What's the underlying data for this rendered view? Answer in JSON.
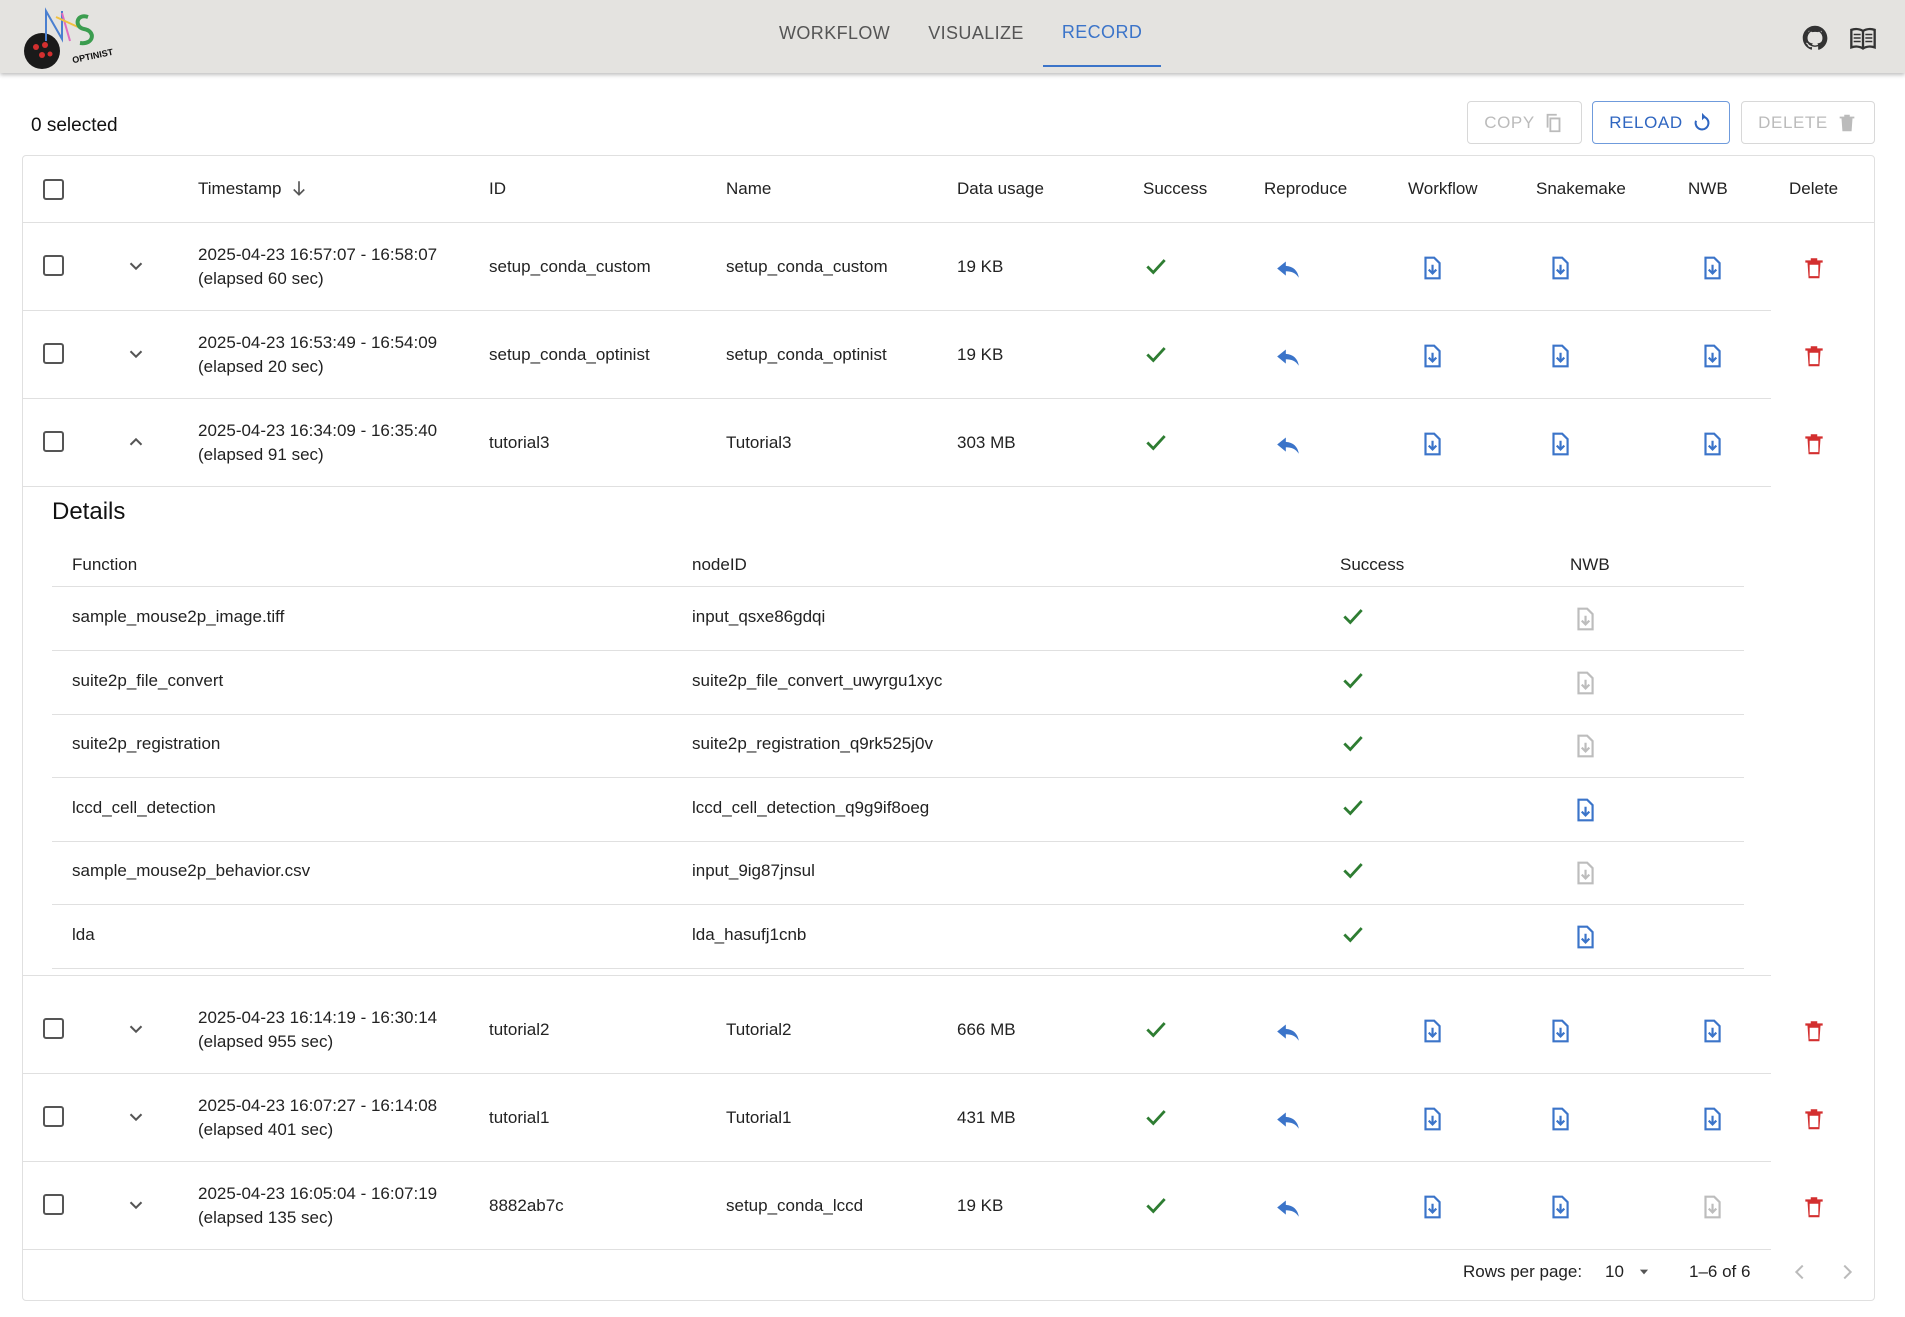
{
  "app": {
    "logo_text": "OPTINIST",
    "nav_tabs": [
      {
        "label": "WORKFLOW"
      },
      {
        "label": "VISUALIZE"
      },
      {
        "label": "RECORD"
      }
    ],
    "active_tab": "RECORD",
    "icons": [
      "github-icon",
      "book-icon"
    ]
  },
  "toolbar": {
    "selected_text": "0 selected",
    "copy_label": "COPY",
    "reload_label": "RELOAD",
    "delete_label": "DELETE"
  },
  "table": {
    "headers": {
      "timestamp": "Timestamp",
      "id": "ID",
      "name": "Name",
      "data_usage": "Data usage",
      "success": "Success",
      "reproduce": "Reproduce",
      "workflow": "Workflow",
      "snakemake": "Snakemake",
      "nwb": "NWB",
      "delete": "Delete"
    },
    "sort_indicator": "arrow-down-icon",
    "rows": [
      {
        "time": "2025-04-23 16:57:07 - 16:58:07",
        "elapsed": "(elapsed 60 sec)",
        "id": "setup_conda_custom",
        "name": "setup_conda_custom",
        "usage": "19 KB",
        "expanded": false,
        "nwb_enabled": true
      },
      {
        "time": "2025-04-23 16:53:49 - 16:54:09",
        "elapsed": "(elapsed 20 sec)",
        "id": "setup_conda_optinist",
        "name": "setup_conda_optinist",
        "usage": "19 KB",
        "expanded": false,
        "nwb_enabled": true
      },
      {
        "time": "2025-04-23 16:34:09 - 16:35:40",
        "elapsed": "(elapsed 91 sec)",
        "id": "tutorial3",
        "name": "Tutorial3",
        "usage": "303 MB",
        "expanded": true,
        "nwb_enabled": true
      },
      {
        "time": "2025-04-23 16:14:19 - 16:30:14",
        "elapsed": "(elapsed 955 sec)",
        "id": "tutorial2",
        "name": "Tutorial2",
        "usage": "666 MB",
        "expanded": false,
        "nwb_enabled": true
      },
      {
        "time": "2025-04-23 16:07:27 - 16:14:08",
        "elapsed": "(elapsed 401 sec)",
        "id": "tutorial1",
        "name": "Tutorial1",
        "usage": "431 MB",
        "expanded": false,
        "nwb_enabled": true
      },
      {
        "time": "2025-04-23 16:05:04 - 16:07:19",
        "elapsed": "(elapsed 135 sec)",
        "id": "8882ab7c",
        "name": "setup_conda_lccd",
        "usage": "19 KB",
        "expanded": false,
        "nwb_enabled": false
      }
    ]
  },
  "details": {
    "title": "Details",
    "headers": {
      "function": "Function",
      "node_id": "nodeID",
      "success": "Success",
      "nwb": "NWB"
    },
    "rows": [
      {
        "function": "sample_mouse2p_image.tiff",
        "node_id": "input_qsxe86gdqi",
        "nwb_enabled": false
      },
      {
        "function": "suite2p_file_convert",
        "node_id": "suite2p_file_convert_uwyrgu1xyc",
        "nwb_enabled": false
      },
      {
        "function": "suite2p_registration",
        "node_id": "suite2p_registration_q9rk525j0v",
        "nwb_enabled": false
      },
      {
        "function": "lccd_cell_detection",
        "node_id": "lccd_cell_detection_q9g9if8oeg",
        "nwb_enabled": true
      },
      {
        "function": "sample_mouse2p_behavior.csv",
        "node_id": "input_9ig87jnsul",
        "nwb_enabled": false
      },
      {
        "function": "lda",
        "node_id": "lda_hasufj1cnb",
        "nwb_enabled": true
      }
    ]
  },
  "pagination": {
    "rows_per_page_label": "Rows per page:",
    "rows_per_page_value": "10",
    "range_text": "1–6 of 6"
  },
  "colors": {
    "accent": "#3b74c9",
    "success": "#2e7d32",
    "delete": "#d32f2f",
    "disabled": "#bdbdbd",
    "appbar": "#e4e3e0"
  }
}
